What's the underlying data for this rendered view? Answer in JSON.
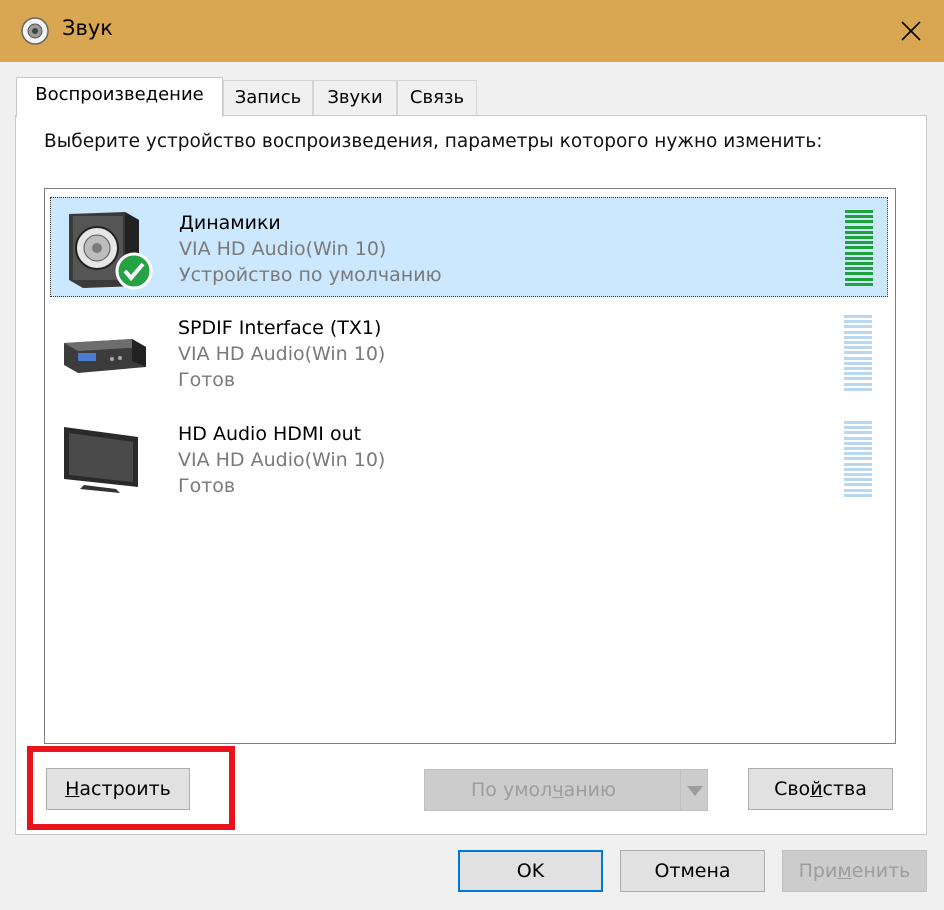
{
  "window": {
    "title": "Звук",
    "app_icon": "speaker-app-icon",
    "close_icon": "close-icon",
    "accent_color": "#d9a651"
  },
  "tabs": [
    {
      "label": "Воспроизведение",
      "active": true
    },
    {
      "label": "Запись",
      "active": false
    },
    {
      "label": "Звуки",
      "active": false
    },
    {
      "label": "Связь",
      "active": false
    }
  ],
  "instruction": "Выберите устройство воспроизведения, параметры которого нужно изменить:",
  "devices": [
    {
      "name": "Динамики",
      "driver": "VIA HD Audio(Win 10)",
      "status": "Устройство по умолчанию",
      "icon": "speaker-icon",
      "badge": "default-check-icon",
      "selected": true,
      "level": 1.0,
      "level_color": "#1fa23a"
    },
    {
      "name": "SPDIF Interface (TX1)",
      "driver": "VIA HD Audio(Win 10)",
      "status": "Готов",
      "icon": "digital-receiver-icon",
      "selected": false,
      "level": 0
    },
    {
      "name": "HD Audio HDMI out",
      "driver": "VIA HD Audio(Win 10)",
      "status": "Готов",
      "icon": "monitor-icon",
      "selected": false,
      "level": 0
    }
  ],
  "buttons": {
    "configure": {
      "pre": "",
      "mnemonic": "Н",
      "post": "астроить"
    },
    "default": {
      "pre": "По умол",
      "mnemonic": "ч",
      "post": "анию",
      "disabled": true
    },
    "properties": {
      "pre": "Сво",
      "mnemonic": "й",
      "post": "ства"
    },
    "ok": "OK",
    "cancel": "Отмена",
    "apply": {
      "pre": "При",
      "mnemonic": "м",
      "post": "енить",
      "disabled": true
    }
  },
  "annotation": {
    "color": "#e8131b"
  }
}
